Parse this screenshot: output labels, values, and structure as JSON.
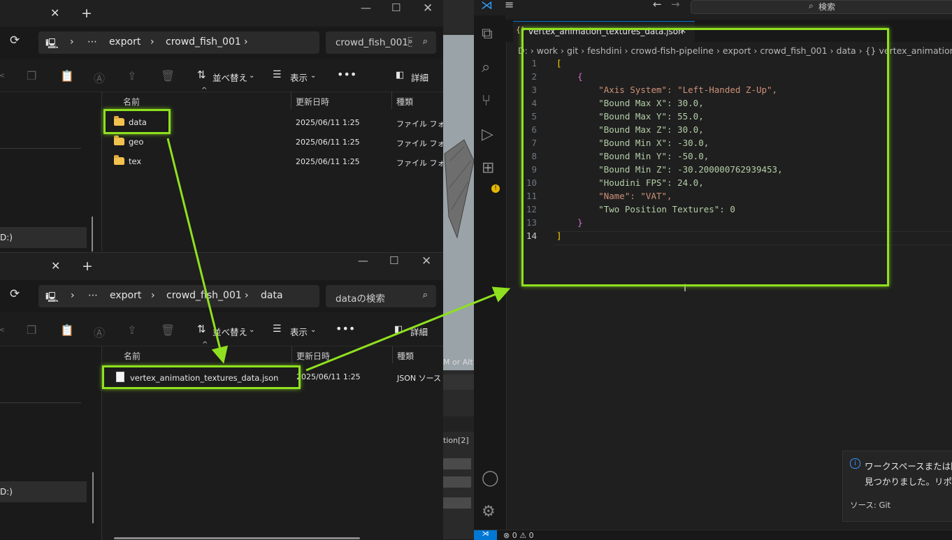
{
  "explorer_top": {
    "address": {
      "overflow": "⋯",
      "crumbs": [
        "export",
        "crowd_fish_001"
      ]
    },
    "search_placeholder": "crowd_fish_001\u0010",
    "toolbar": {
      "sort": "並べ替え",
      "view": "表示",
      "details": "詳細"
    },
    "columns": {
      "name": "名前",
      "date": "更新日時",
      "type": "種類"
    },
    "rows": [
      {
        "name": "data",
        "date": "2025/06/11 1:25",
        "type": "ファイル フォルダー"
      },
      {
        "name": "geo",
        "date": "2025/06/11 1:25",
        "type": "ファイル フォルダー"
      },
      {
        "name": "tex",
        "date": "2025/06/11 1:25",
        "type": "ファイル フォルダー"
      }
    ],
    "nav_drive": "D:)"
  },
  "explorer_bottom": {
    "address": {
      "overflow": "⋯",
      "crumbs": [
        "export",
        "crowd_fish_001",
        "data"
      ]
    },
    "search_placeholder": "dataの検索",
    "toolbar": {
      "sort": "並べ替え",
      "view": "表示",
      "details": "詳細"
    },
    "columns": {
      "name": "名前",
      "date": "更新日時",
      "type": "種類"
    },
    "rows": [
      {
        "name": "vertex_animation_textures_data.json",
        "date": "2025/06/11 1:25",
        "type": "JSON ソース ファイル"
      }
    ],
    "nav_drive": "D:)"
  },
  "houdini_bg": {
    "hint": "M or Alt+M",
    "tab": "tion[2]"
  },
  "vscode": {
    "search": "検索",
    "tab_label": "vertex_animation_textures_data.json",
    "breadcrumb": "D: › work › git › feshdini › crowd-fish-pipeline › export › crowd_fish_001 › data › {} vertex_animation_te",
    "json_lines": [
      "[",
      "    {",
      "        \"Axis System\": \"Left-Handed Z-Up\",",
      "        \"Bound Max X\": 30.0,",
      "        \"Bound Max Y\": 55.0,",
      "        \"Bound Max Z\": 30.0,",
      "        \"Bound Min X\": -30.0,",
      "        \"Bound Min Y\": -50.0,",
      "        \"Bound Min Z\": -30.200000762939453,",
      "        \"Houdini FPS\": 24.0,",
      "        \"Name\": \"VAT\",",
      "        \"Two Position Textures\": 0",
      "    }",
      "]"
    ],
    "notification": {
      "line1": "ワークスペースまたは開いて",
      "line2": "見つかりました。リポジトリ",
      "source": "ソース: Git"
    },
    "status": {
      "errors": "⊗ 0 ⚠ 0"
    }
  },
  "colors": {
    "highlight": "#8fe01f",
    "accent": "#0078d4"
  }
}
